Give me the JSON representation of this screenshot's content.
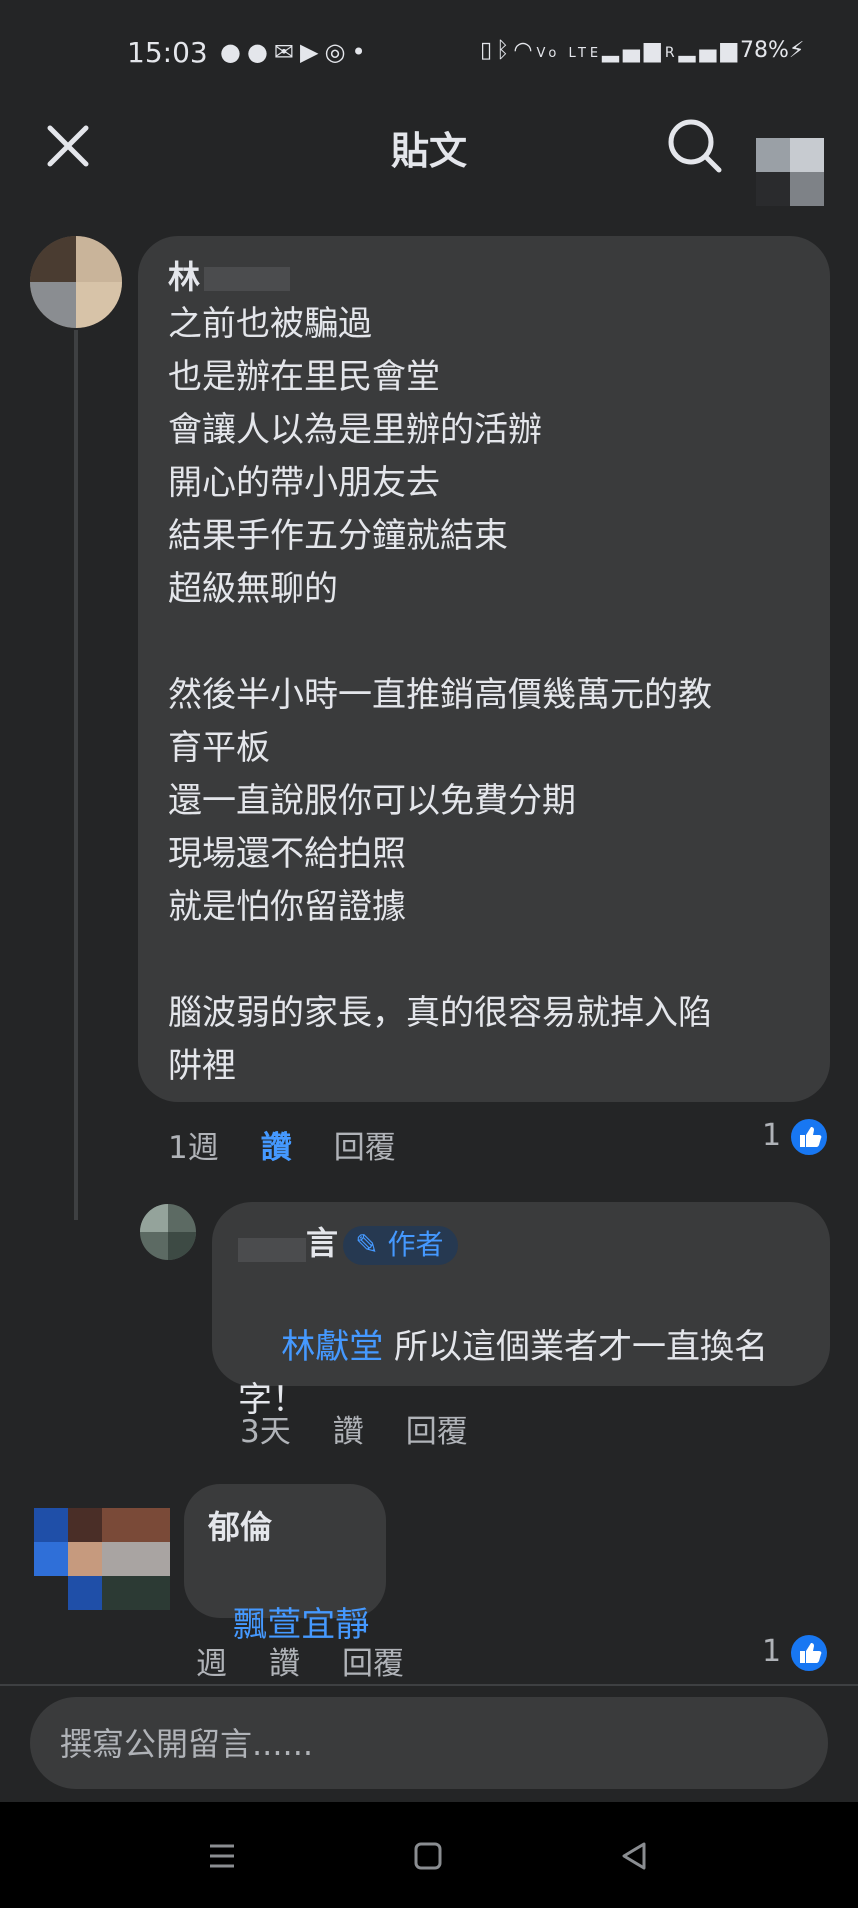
{
  "status_bar": {
    "time": "15:03",
    "battery": "78%",
    "icons": [
      "line-icon",
      "chat-icon",
      "mail-icon",
      "youtube-icon",
      "instagram-icon",
      "dot-icon",
      "vibrate-icon",
      "bluetooth-icon",
      "wifi-icon",
      "volte-icon",
      "signal-icon",
      "signal-r-icon",
      "charging-icon"
    ],
    "volte_label": "Vo LTE",
    "roaming_label": "R"
  },
  "header": {
    "title": "貼文"
  },
  "comments": [
    {
      "author_partial": "林",
      "text": "之前也被騙過\n也是辦在里民會堂\n會讓人以為是里辦的活辦\n開心的帶小朋友去\n結果手作五分鐘就結束\n超級無聊的\n\n然後半小時一直推銷高價幾萬元的教\n育平板\n還一直說服你可以免費分期\n現場還不給拍照\n就是怕你留證據\n\n腦波弱的家長，真的很容易就掉入陷\n阱裡",
      "time": "1週",
      "like_label": "讚",
      "reply_label": "回覆",
      "like_count": "1"
    },
    {
      "author_partial": "言",
      "author_badge": "作者",
      "mention": "林獻堂",
      "text": "所以這個業者才一直換名\n字！",
      "time": "3天",
      "like_label": "讚",
      "reply_label": "回覆"
    },
    {
      "author_partial": "郁倫",
      "mention": "飄萱宜靜",
      "time": "週",
      "like_label": "讚",
      "reply_label": "回覆",
      "like_count": "1"
    }
  ],
  "composer": {
    "placeholder": "撰寫公開留言......"
  },
  "colors": {
    "background": "#242526",
    "bubble": "#3a3b3c",
    "accent": "#4599ff",
    "like_blue": "#1877f2"
  }
}
